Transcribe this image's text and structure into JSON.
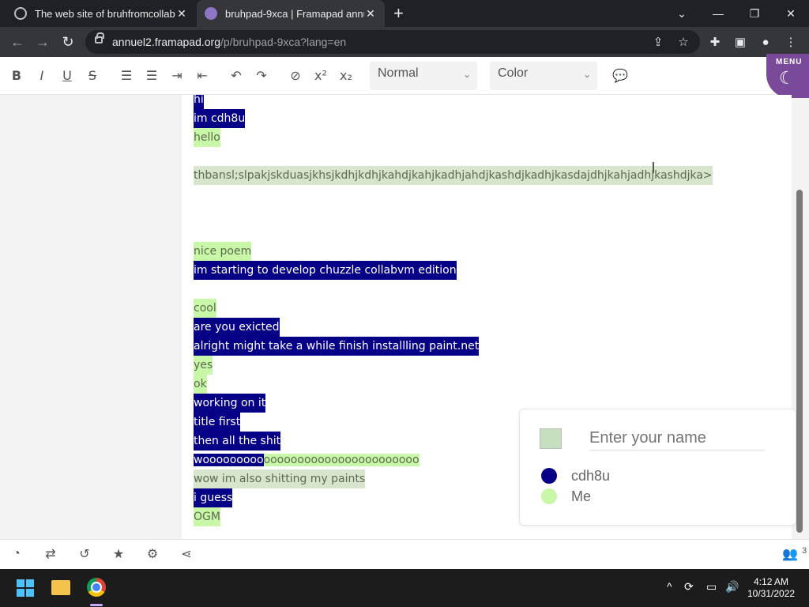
{
  "browser": {
    "tabs": [
      {
        "title": "The web site of bruhfromcollabvm",
        "close": "✕"
      },
      {
        "title": "bruhpad-9xca | Framapad annuel",
        "close": "✕"
      }
    ],
    "new_tab": "+",
    "url_host": "annuel2.framapad.org",
    "url_path": "/p/bruhpad-9xca?lang=en"
  },
  "editor_toolbar": {
    "bold": "B",
    "italic": "I",
    "underline": "U",
    "strike": "S",
    "heading_select": "Normal",
    "color_select": "Color",
    "menu_label": "MENU"
  },
  "document": {
    "lines": [
      {
        "text": "hi",
        "author": "cd"
      },
      {
        "text": "im cdh8u",
        "author": "cd"
      },
      {
        "text": "hello",
        "author": "me"
      },
      {
        "text": "thbansl;slpakjskduasjkhsjkdhjkdhjkahdjkahjkadhjahdjkashdjkadhjkasdajdhjkahjadhjkashdjka>",
        "author": "gr"
      },
      {
        "text": "nice poem",
        "author": "me"
      },
      {
        "text": "im starting to develop chuzzle collabvm edition",
        "author": "cd"
      },
      {
        "text": "cool",
        "author": "me"
      },
      {
        "text": "are you exicted",
        "author": "cd"
      },
      {
        "text": "alright might take a while finish installling paint.net",
        "author": "cd"
      },
      {
        "text": "yes",
        "author": "me"
      },
      {
        "text": "ok",
        "author": "me"
      },
      {
        "text": "working on it",
        "author": "cd"
      },
      {
        "text": "title first",
        "author": "cd"
      },
      {
        "text": "then all the shit",
        "author": "cd"
      },
      {
        "text": "wooooooooo",
        "author": "cd"
      },
      {
        "text": "ooooooooooooooooooooooo",
        "author": "me"
      },
      {
        "text": "wow im also shitting my paints",
        "author": "gr"
      },
      {
        "text": "i guess",
        "author": "cd"
      },
      {
        "text": "OGM",
        "author": "me"
      }
    ]
  },
  "users_panel": {
    "name_placeholder": "Enter your name",
    "users": [
      {
        "name": "cdh8u",
        "color": "#060086"
      },
      {
        "name": "Me",
        "color": "#c9f7a8"
      }
    ]
  },
  "bottom_bar": {
    "user_count": "3"
  },
  "taskbar": {
    "time": "4:12 AM",
    "date": "10/31/2022"
  }
}
